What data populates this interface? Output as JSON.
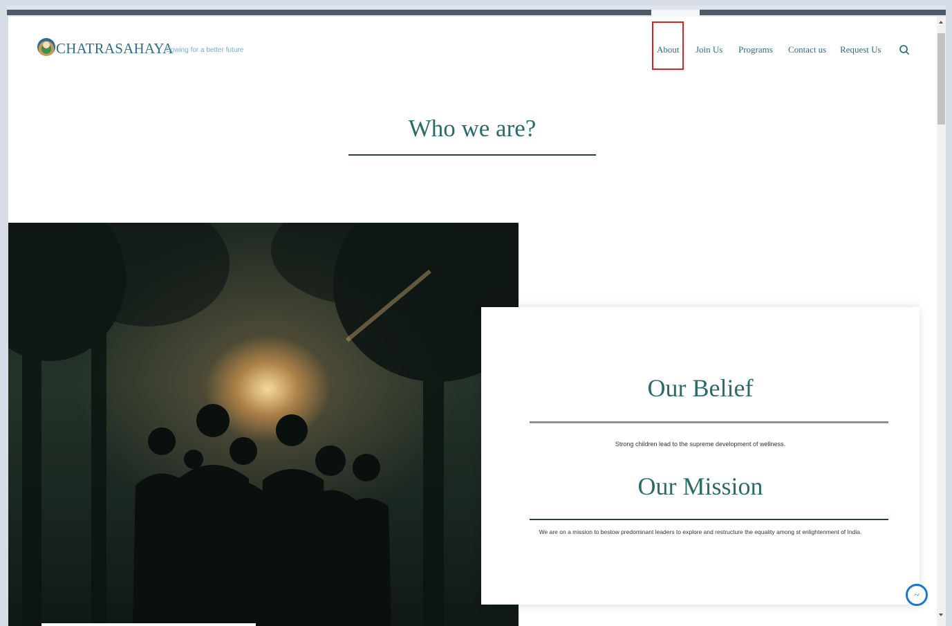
{
  "header": {
    "brand": "CHATRASAHAYA",
    "tagline": "Sowing for a better future"
  },
  "nav": {
    "items": [
      {
        "label": "About"
      },
      {
        "label": "Join Us"
      },
      {
        "label": "Programs"
      },
      {
        "label": "Contact us"
      },
      {
        "label": "Request Us"
      }
    ],
    "search_icon": "search-icon",
    "highlighted": "About"
  },
  "main": {
    "heading": "Who we are?",
    "belief": {
      "title": "Our Belief",
      "text": "Strong children lead to the supreme development of wellness."
    },
    "mission": {
      "title": "Our Mission",
      "text": "We are on a mission to bestow predominant leaders to explore and restructure the equality among st enlightenment of India."
    }
  },
  "widgets": {
    "messenger_icon": "messenger-icon"
  },
  "colors": {
    "accent": "#2a6b6b",
    "nav_text": "#2f6f82",
    "highlight_box": "#e02020",
    "messenger": "#1877d2"
  }
}
